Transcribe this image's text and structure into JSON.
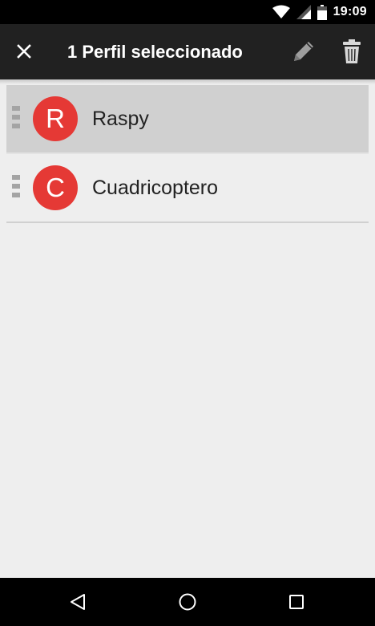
{
  "status_bar": {
    "time": "19:09",
    "icons": [
      "wifi-icon",
      "cell-signal-icon",
      "battery-icon"
    ]
  },
  "action_bar": {
    "title": "1 Perfil seleccionado",
    "icons": [
      "close-icon",
      "pencil-icon",
      "trash-icon"
    ],
    "background_color": "#212121"
  },
  "profiles": [
    {
      "initial": "R",
      "name": "Raspy",
      "selected": true,
      "avatar_color": "#e53935"
    },
    {
      "initial": "C",
      "name": "Cuadricoptero",
      "selected": false,
      "avatar_color": "#e53935"
    }
  ],
  "nav_bar": {
    "icons": [
      "back-icon",
      "home-icon",
      "recents-icon"
    ]
  }
}
